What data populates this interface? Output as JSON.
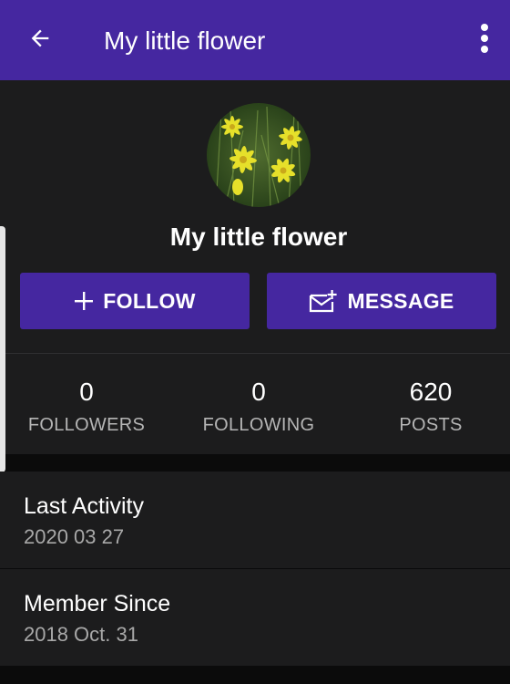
{
  "appbar": {
    "title": "My little flower",
    "back_icon": "arrow-left-icon",
    "menu_icon": "more-vert-icon",
    "color": "#4527a0"
  },
  "profile": {
    "name": "My little flower",
    "avatar_icon": "yellow-flowers-photo"
  },
  "actions": {
    "follow_label": "FOLLOW",
    "follow_icon": "plus-icon",
    "message_label": "MESSAGE",
    "message_icon": "mail-plus-icon"
  },
  "stats": [
    {
      "value": "0",
      "label": "FOLLOWERS"
    },
    {
      "value": "0",
      "label": "FOLLOWING"
    },
    {
      "value": "620",
      "label": "POSTS"
    }
  ],
  "info": {
    "last_activity_label": "Last Activity",
    "last_activity_value": "2020 03 27",
    "member_since_label": "Member Since",
    "member_since_value": "2018 Oct. 31"
  }
}
